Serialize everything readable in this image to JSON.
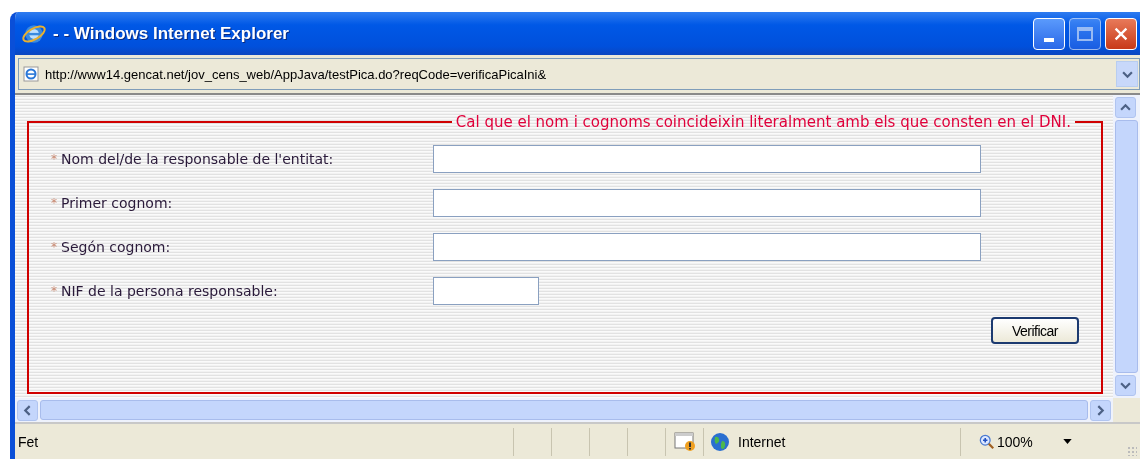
{
  "window": {
    "title": "- - Windows Internet Explorer"
  },
  "address_bar": {
    "url": "http://www14.gencat.net/jov_cens_web/AppJava/testPica.do?reqCode=verificaPicaIni&"
  },
  "form": {
    "legend": "Cal que el nom i cognoms coincideixin literalment amb els que consten en el DNI.",
    "fields": [
      {
        "mark": "*",
        "label": "Nom del/de la responsable de l'entitat:",
        "kind": "long"
      },
      {
        "mark": "*",
        "label": "Primer cognom:",
        "kind": "long"
      },
      {
        "mark": "*",
        "label": "Segón cognom:",
        "kind": "long"
      },
      {
        "mark": "*",
        "label": "NIF de la persona responsable:",
        "kind": "short"
      }
    ],
    "button": "Verificar"
  },
  "status_bar": {
    "text": "Fet",
    "zone": "Internet",
    "zoom": "100%"
  }
}
